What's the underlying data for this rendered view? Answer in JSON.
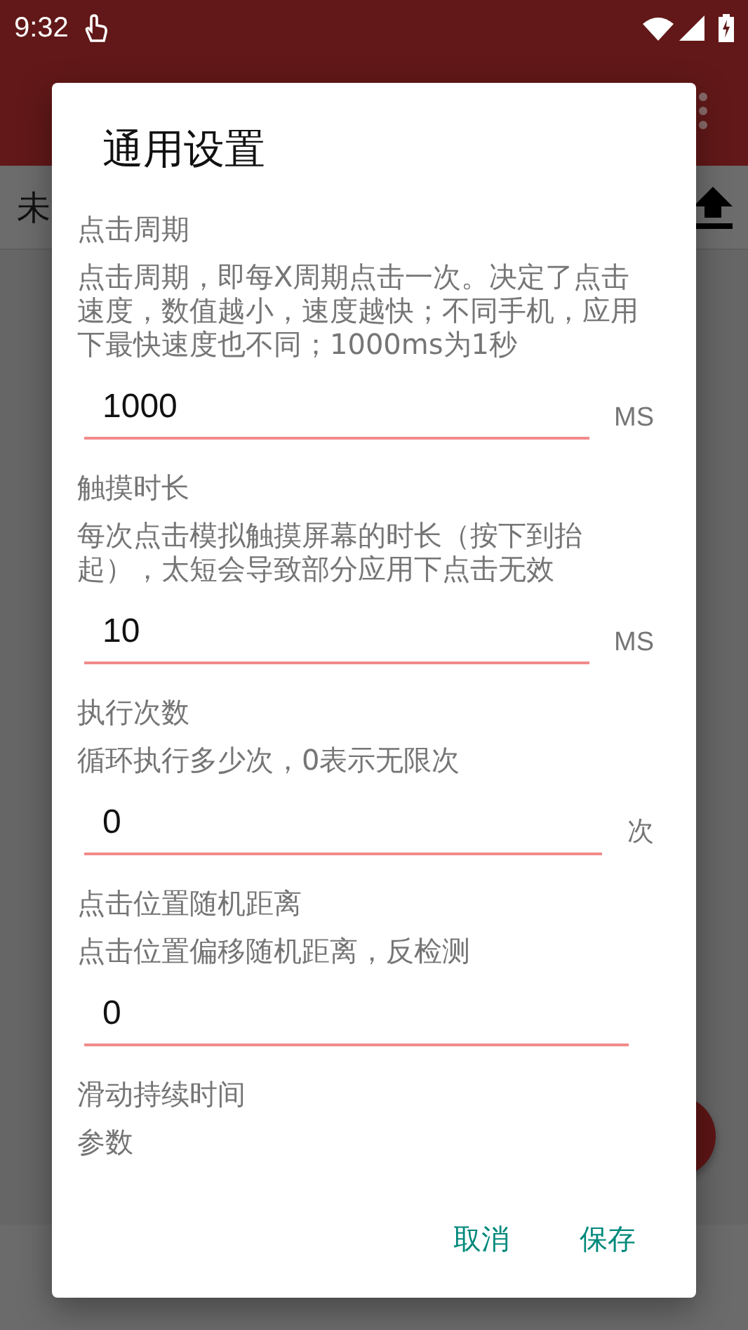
{
  "status_bar": {
    "time": "9:32"
  },
  "list_row": {
    "text": "未"
  },
  "dialog": {
    "title": "通用设置",
    "settings": [
      {
        "label": "点击周期",
        "description": "点击周期，即每X周期点击一次。决定了点击速度，数值越小，速度越快；不同手机，应用下最快速度也不同；1000ms为1秒",
        "value": "1000",
        "unit": "MS"
      },
      {
        "label": "触摸时长",
        "description": "每次点击模拟触摸屏幕的时长（按下到抬起），太短会导致部分应用下点击无效",
        "value": "10",
        "unit": "MS"
      },
      {
        "label": "执行次数",
        "description": "循环执行多少次，0表示无限次",
        "value": "0",
        "unit": "次"
      },
      {
        "label": "点击位置随机距离",
        "description": "点击位置偏移随机距离，反检测",
        "value": "0"
      },
      {
        "label": "滑动持续时间",
        "description": "参数"
      }
    ],
    "buttons": [
      "取消",
      "保存"
    ]
  }
}
